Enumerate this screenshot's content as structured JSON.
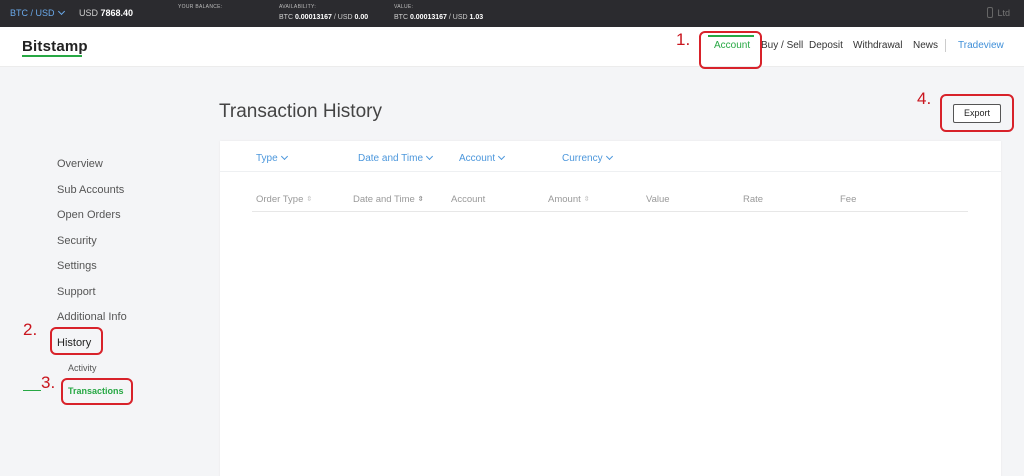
{
  "topbar": {
    "pair": "BTC / USD",
    "price_currency": "USD",
    "price_value": "7868.40",
    "balance_label": "YOUR BALANCE:",
    "availability_label": "AVAILABILITY:",
    "availability_btc_prefix": "BTC",
    "availability_btc": "0.00013167",
    "availability_usd_prefix": "/ USD",
    "availability_usd": "0.00",
    "value_label": "VALUE:",
    "value_btc_prefix": "BTC",
    "value_btc": "0.00013167",
    "value_usd_prefix": "/ USD",
    "value_usd": "1.03",
    "account_name": "Ltd"
  },
  "header": {
    "logo": "Bitstamp",
    "nav": [
      "Account",
      "Buy / Sell",
      "Deposit",
      "Withdrawal",
      "News"
    ],
    "tradeview": "Tradeview"
  },
  "annotations": [
    "1.",
    "2.",
    "3.",
    "4."
  ],
  "sidebar": {
    "items": [
      "Overview",
      "Sub Accounts",
      "Open Orders",
      "Security",
      "Settings",
      "Support",
      "Additional Info",
      "History"
    ],
    "sub_items": [
      "Activity",
      "Transactions"
    ]
  },
  "main": {
    "title": "Transaction History",
    "export_label": "Export",
    "filters": [
      "Type",
      "Date and Time",
      "Account",
      "Currency"
    ],
    "columns": [
      "Order Type",
      "Date and Time",
      "Account",
      "Amount",
      "Value",
      "Rate",
      "Fee"
    ]
  },
  "colors": {
    "accent_green": "#27a844",
    "link_blue": "#4c97dc",
    "annotation_red": "#d8222a"
  }
}
